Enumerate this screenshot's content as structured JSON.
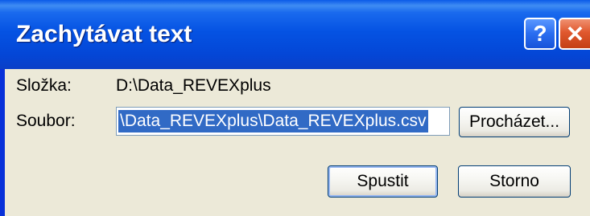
{
  "window": {
    "title": "Zachytávat text",
    "help_glyph": "?",
    "close_glyph": "✕"
  },
  "form": {
    "folder_label": "Složka:",
    "folder_value": "D:\\Data_REVEXplus",
    "file_label": "Soubor:",
    "file_value": "\\Data_REVEXplus\\Data_REVEXplus.csv",
    "browse_label": "Procházet..."
  },
  "actions": {
    "run_label": "Spustit",
    "cancel_label": "Storno"
  },
  "colors": {
    "titlebar": "#0553e3",
    "client": "#ece9d8",
    "selection": "#316ac5",
    "close_button": "#e0582e"
  }
}
